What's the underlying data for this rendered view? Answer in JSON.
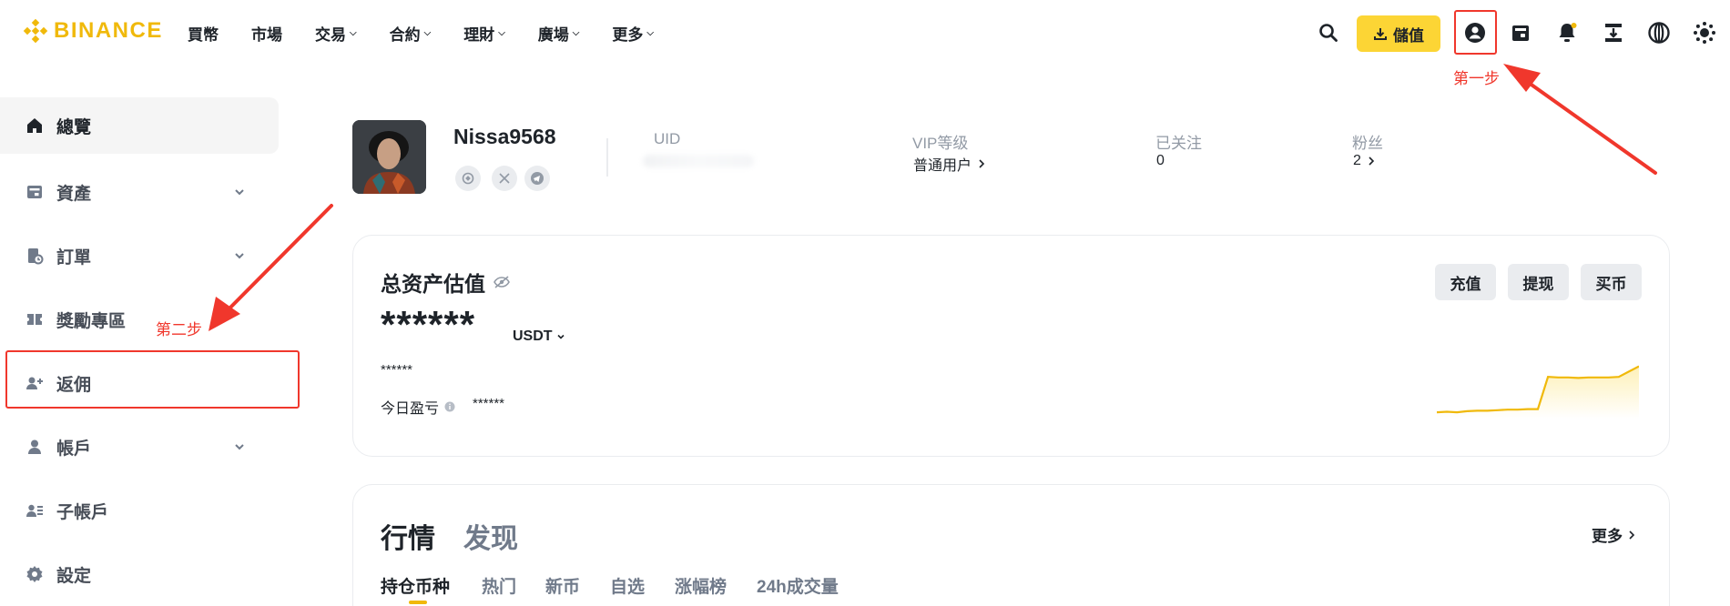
{
  "brand": {
    "name": "BINANCE",
    "color": "#f0b90b"
  },
  "nav": [
    {
      "label": "買幣",
      "has_menu": false
    },
    {
      "label": "市場",
      "has_menu": false
    },
    {
      "label": "交易",
      "has_menu": true
    },
    {
      "label": "合約",
      "has_menu": true
    },
    {
      "label": "理財",
      "has_menu": true
    },
    {
      "label": "廣場",
      "has_menu": true
    },
    {
      "label": "更多",
      "has_menu": true
    }
  ],
  "header_actions": {
    "deposit_label": "儲值",
    "icons": [
      "search-icon",
      "download-icon",
      "user-icon",
      "wallet-icon",
      "bell-icon",
      "transfer-icon",
      "globe-icon",
      "theme-icon"
    ]
  },
  "sidebar": {
    "items": [
      {
        "label": "總覽",
        "icon": "home-icon",
        "active": true,
        "expandable": false
      },
      {
        "label": "資產",
        "icon": "wallet-icon",
        "active": false,
        "expandable": true
      },
      {
        "label": "訂單",
        "icon": "order-icon",
        "active": false,
        "expandable": true
      },
      {
        "label": "獎勵專區",
        "icon": "ticket-icon",
        "active": false,
        "expandable": false
      },
      {
        "label": "返佣",
        "icon": "add-user-icon",
        "active": false,
        "expandable": false
      },
      {
        "label": "帳戶",
        "icon": "user-icon",
        "active": false,
        "expandable": true
      },
      {
        "label": "子帳戶",
        "icon": "sub-account-icon",
        "active": false,
        "expandable": false
      },
      {
        "label": "設定",
        "icon": "gear-icon",
        "active": false,
        "expandable": false
      }
    ]
  },
  "profile": {
    "username": "Nissa9568",
    "uid_label": "UID",
    "vip_label": "VIP等级",
    "vip_value": "普通用户",
    "following_label": "已关注",
    "following_value": "0",
    "followers_label": "粉丝",
    "followers_value": "2"
  },
  "assets": {
    "title": "总资产估值",
    "hidden_balance": "******",
    "currency": "USDT",
    "hidden_fiat": "******",
    "pnl_label": "今日盈亏",
    "pnl_value": "******",
    "buttons": [
      "充值",
      "提现",
      "买币"
    ],
    "trend": [
      0.05,
      0.06,
      0.05,
      0.07,
      0.08,
      0.08,
      0.09,
      0.1,
      0.1,
      0.11,
      0.11,
      0.72,
      0.71,
      0.71,
      0.7,
      0.71,
      0.71,
      0.71,
      0.72,
      0.82,
      0.92
    ]
  },
  "market": {
    "tabs": [
      "行情",
      "发现"
    ],
    "more_label": "更多",
    "sub_tabs": [
      "持仓币种",
      "热门",
      "新币",
      "自选",
      "涨幅榜",
      "24h成交量"
    ]
  },
  "annotations": {
    "step1": "第一步",
    "step2": "第二步",
    "color": "#f0372c"
  }
}
